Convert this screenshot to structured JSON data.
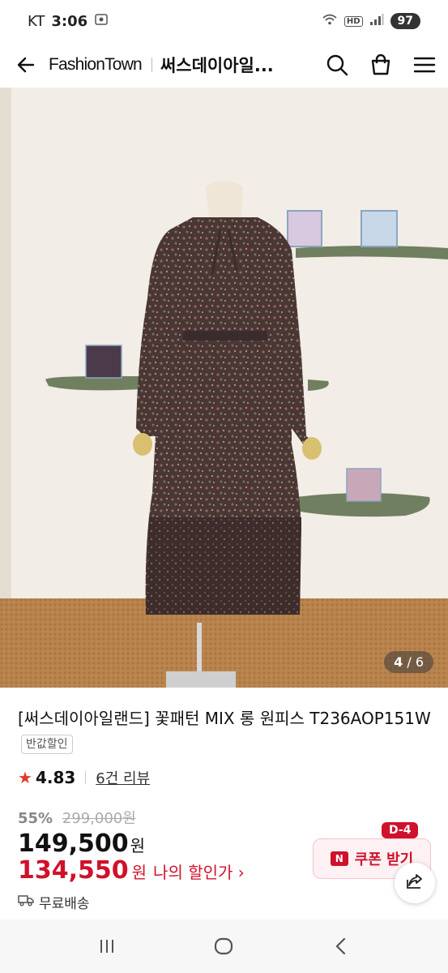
{
  "status_bar": {
    "carrier": "KT",
    "time": "3:06",
    "network_badge": "HD",
    "battery": "97"
  },
  "header": {
    "brand": "FashionTown",
    "shop_name": "써스데이아일...",
    "icons": [
      "back-arrow-icon",
      "search-icon",
      "shopping-bag-icon",
      "menu-icon"
    ]
  },
  "image": {
    "current": "4",
    "total": "6"
  },
  "product": {
    "title": "[써스데이아일랜드] 꽃패턴 MIX 롱 원피스 T236AOP151W",
    "badge": "반값할인",
    "rating": "4.83",
    "review_link": "6건 리뷰"
  },
  "price": {
    "discount_rate": "55%",
    "original_price": "299,000원",
    "sale_price": "149,500",
    "currency": "원",
    "my_price": "134,550",
    "my_price_label": "나의 할인가 ›"
  },
  "shipping": {
    "label": "무료배송"
  },
  "coupon": {
    "dday": "D-4",
    "badge": "N",
    "label": "쿠폰 받기"
  },
  "colors": {
    "accent": "#d0112b",
    "coupon_bg": "#fdf1f3",
    "star": "#e8352a"
  }
}
